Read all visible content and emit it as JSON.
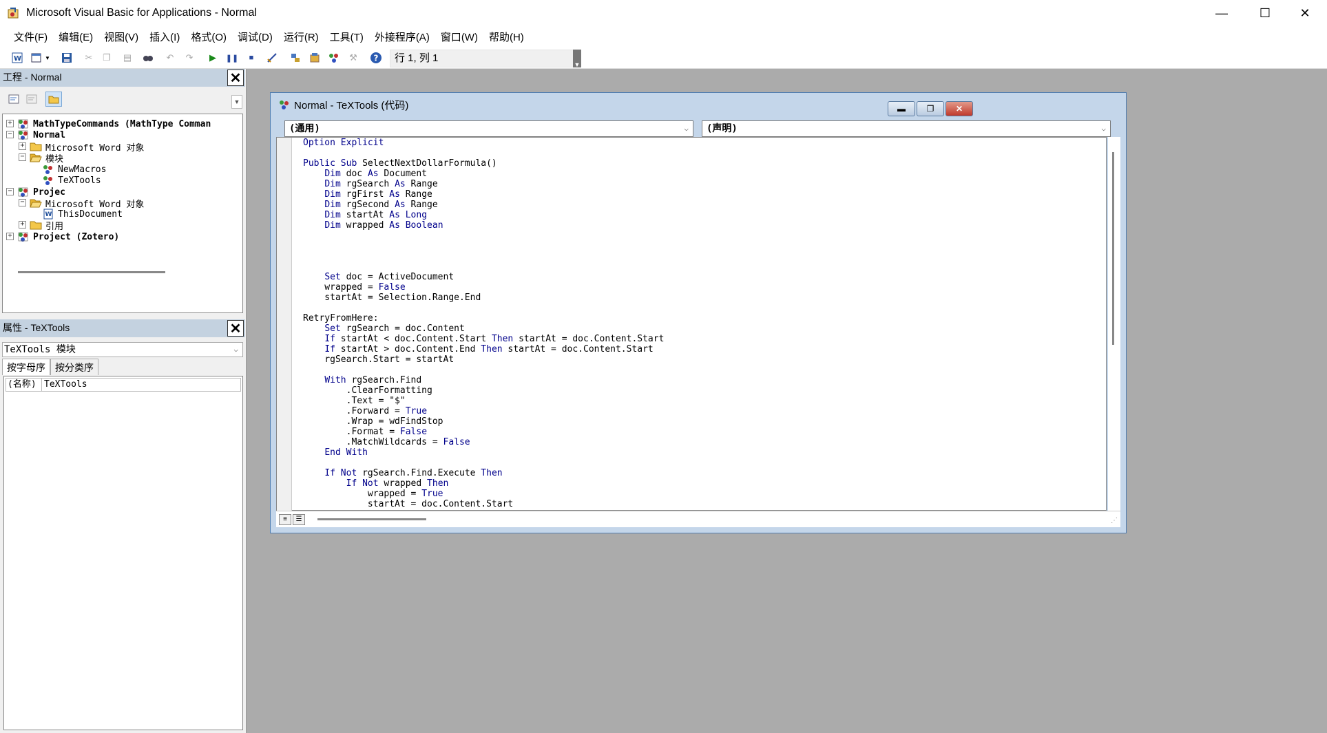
{
  "window": {
    "title": "Microsoft Visual Basic for Applications - Normal",
    "minimize_glyph": "—",
    "maximize_glyph": "☐",
    "close_glyph": "✕"
  },
  "menu": {
    "items": [
      "文件(F)",
      "编辑(E)",
      "视图(V)",
      "插入(I)",
      "格式(O)",
      "调试(D)",
      "运行(R)",
      "工具(T)",
      "外接程序(A)",
      "窗口(W)",
      "帮助(H)"
    ]
  },
  "toolbar": {
    "position": "行 1, 列 1",
    "icons": [
      "word-icon",
      "insert-userform-icon",
      "save-icon",
      "cut-icon",
      "copy-icon",
      "paste-icon",
      "find-icon",
      "undo-icon",
      "redo-icon",
      "run-icon",
      "break-icon",
      "reset-icon",
      "design-mode-icon",
      "project-explorer-icon",
      "properties-window-icon",
      "object-browser-icon",
      "toolbox-icon",
      "help-icon"
    ]
  },
  "project_pane": {
    "title": "工程 - Normal",
    "close": "✕",
    "tree": [
      {
        "label": "MathTypeCommands (MathType Comman",
        "level": 0,
        "expander": "+",
        "icon": "vba-project-icon",
        "bold": true
      },
      {
        "label": "Normal",
        "level": 0,
        "expander": "−",
        "icon": "vba-project-icon",
        "bold": true
      },
      {
        "label": "Microsoft Word 对象",
        "level": 1,
        "expander": "+",
        "icon": "folder-icon",
        "bold": false
      },
      {
        "label": "模块",
        "level": 1,
        "expander": "−",
        "icon": "folder-open-icon",
        "bold": false
      },
      {
        "label": "NewMacros",
        "level": 2,
        "expander": "",
        "icon": "module-icon",
        "bold": false
      },
      {
        "label": "TeXTools",
        "level": 2,
        "expander": "",
        "icon": "module-icon",
        "bold": false
      },
      {
        "label": "Projec",
        "level": 0,
        "expander": "−",
        "icon": "vba-project-icon",
        "bold": true
      },
      {
        "label": "Microsoft Word 对象",
        "level": 1,
        "expander": "−",
        "icon": "folder-open-icon",
        "bold": false
      },
      {
        "label": "ThisDocument",
        "level": 2,
        "expander": "",
        "icon": "word-document-icon",
        "bold": false
      },
      {
        "label": "引用",
        "level": 1,
        "expander": "+",
        "icon": "folder-icon",
        "bold": false
      },
      {
        "label": "Project (Zotero)",
        "level": 0,
        "expander": "+",
        "icon": "vba-project-icon",
        "bold": true
      }
    ]
  },
  "properties_pane": {
    "title": "属性 - TeXTools",
    "close": "✕",
    "combo": "TeXTools 模块",
    "tabs": [
      "按字母序",
      "按分类序"
    ],
    "row_key": "(名称)",
    "row_value": "TeXTools"
  },
  "code_window": {
    "title": "Normal - TeXTools (代码)",
    "object_combo": "(通用)",
    "proc_combo": "(声明)",
    "code_lines": [
      [
        [
          "kw",
          "Option Explicit"
        ]
      ],
      [],
      [
        [
          "kw",
          "Public Sub "
        ],
        [
          "",
          "SelectNextDollarFormula()"
        ]
      ],
      [
        [
          "",
          "    "
        ],
        [
          "kw",
          "Dim"
        ],
        [
          "",
          " doc "
        ],
        [
          "kw",
          "As"
        ],
        [
          "",
          " Document"
        ]
      ],
      [
        [
          "",
          "    "
        ],
        [
          "kw",
          "Dim"
        ],
        [
          "",
          " rgSearch "
        ],
        [
          "kw",
          "As"
        ],
        [
          "",
          " Range"
        ]
      ],
      [
        [
          "",
          "    "
        ],
        [
          "kw",
          "Dim"
        ],
        [
          "",
          " rgFirst "
        ],
        [
          "kw",
          "As"
        ],
        [
          "",
          " Range"
        ]
      ],
      [
        [
          "",
          "    "
        ],
        [
          "kw",
          "Dim"
        ],
        [
          "",
          " rgSecond "
        ],
        [
          "kw",
          "As"
        ],
        [
          "",
          " Range"
        ]
      ],
      [
        [
          "",
          "    "
        ],
        [
          "kw",
          "Dim"
        ],
        [
          "",
          " startAt "
        ],
        [
          "kw",
          "As Long"
        ]
      ],
      [
        [
          "",
          "    "
        ],
        [
          "kw",
          "Dim"
        ],
        [
          "",
          " wrapped "
        ],
        [
          "kw",
          "As Boolean"
        ]
      ],
      [],
      [],
      [],
      [],
      [
        [
          "",
          "    "
        ],
        [
          "kw",
          "Set"
        ],
        [
          "",
          " doc = ActiveDocument"
        ]
      ],
      [
        [
          "",
          "    wrapped = "
        ],
        [
          "kw",
          "False"
        ]
      ],
      [
        [
          "",
          "    startAt = Selection.Range.End"
        ]
      ],
      [],
      [
        [
          "",
          "RetryFromHere:"
        ]
      ],
      [
        [
          "",
          "    "
        ],
        [
          "kw",
          "Set"
        ],
        [
          "",
          " rgSearch = doc.Content"
        ]
      ],
      [
        [
          "",
          "    "
        ],
        [
          "kw",
          "If"
        ],
        [
          "",
          " startAt < doc.Content.Start "
        ],
        [
          "kw",
          "Then"
        ],
        [
          "",
          " startAt = doc.Content.Start"
        ]
      ],
      [
        [
          "",
          "    "
        ],
        [
          "kw",
          "If"
        ],
        [
          "",
          " startAt > doc.Content.End "
        ],
        [
          "kw",
          "Then"
        ],
        [
          "",
          " startAt = doc.Content.Start"
        ]
      ],
      [
        [
          "",
          "    rgSearch.Start = startAt"
        ]
      ],
      [],
      [
        [
          "",
          "    "
        ],
        [
          "kw",
          "With"
        ],
        [
          "",
          " rgSearch.Find"
        ]
      ],
      [
        [
          "",
          "        .ClearFormatting"
        ]
      ],
      [
        [
          "",
          "        .Text = \"$\""
        ]
      ],
      [
        [
          "",
          "        .Forward = "
        ],
        [
          "kw",
          "True"
        ]
      ],
      [
        [
          "",
          "        .Wrap = wdFindStop"
        ]
      ],
      [
        [
          "",
          "        .Format = "
        ],
        [
          "kw",
          "False"
        ]
      ],
      [
        [
          "",
          "        .MatchWildcards = "
        ],
        [
          "kw",
          "False"
        ]
      ],
      [
        [
          "",
          "    "
        ],
        [
          "kw",
          "End With"
        ]
      ],
      [],
      [
        [
          "",
          "    "
        ],
        [
          "kw",
          "If Not"
        ],
        [
          "",
          " rgSearch.Find.Execute "
        ],
        [
          "kw",
          "Then"
        ]
      ],
      [
        [
          "",
          "        "
        ],
        [
          "kw",
          "If Not"
        ],
        [
          "",
          " wrapped "
        ],
        [
          "kw",
          "Then"
        ]
      ],
      [
        [
          "",
          "            wrapped = "
        ],
        [
          "kw",
          "True"
        ]
      ],
      [
        [
          "",
          "            startAt = doc.Content.Start"
        ]
      ]
    ],
    "colors": {
      "keyword": "#00008b",
      "titlebar": "#c4d6ea"
    }
  }
}
